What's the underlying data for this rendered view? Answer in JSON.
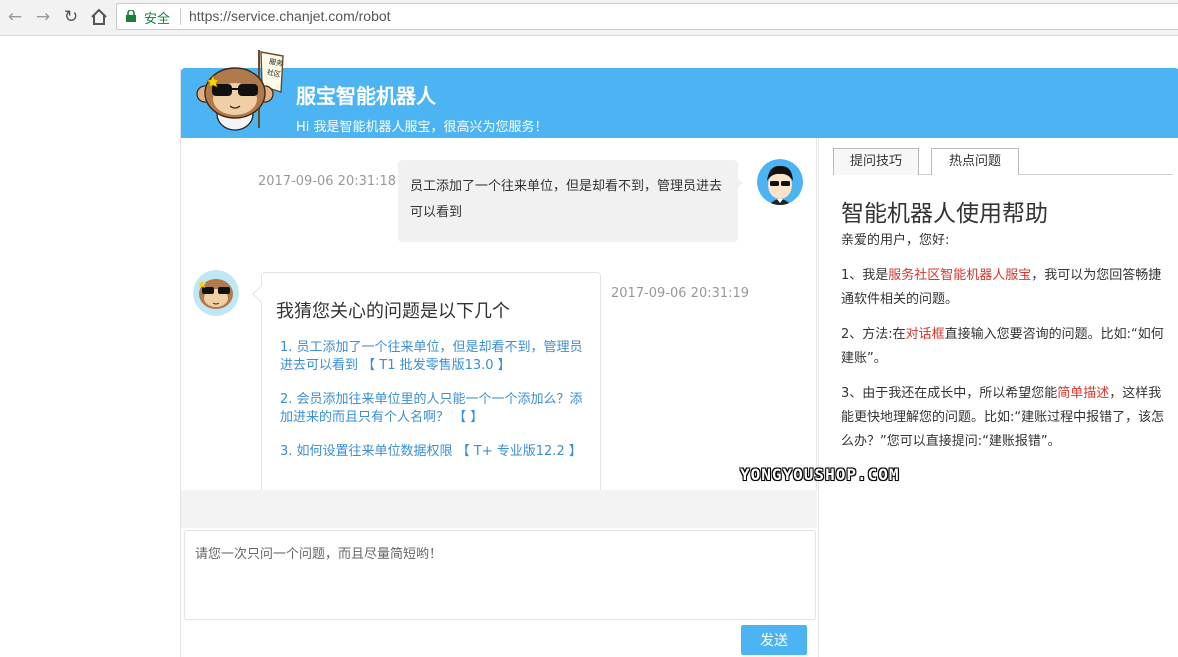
{
  "browser": {
    "security_label": "安全",
    "url": "https://service.chanjet.com/robot"
  },
  "header": {
    "title": "服宝智能机器人",
    "subtitle": "Hi 我是智能机器人服宝，很高兴为您服务！",
    "mascot_sign": "服务社区"
  },
  "chat": {
    "user_message": {
      "timestamp": "2017-09-06 20:31:18",
      "text": "员工添加了一个往来单位，但是却看不到，管理员进去可以看到"
    },
    "bot_message": {
      "timestamp": "2017-09-06 20:31:19",
      "title": "我猜您关心的问题是以下几个",
      "items": [
        "1. 员工添加了一个往来单位，但是却看不到，管理员进去可以看到 【 T1 批发零售版13.0 】",
        "2. 会员添加往来单位里的人只能一个一个添加么？添加进来的而且只有个人名啊？ 【 】",
        "3. 如何设置往来单位数据权限 【 T+ 专业版12.2 】"
      ]
    },
    "input_placeholder": "请您一次只问一个问题，而且尽量简短哟！",
    "send_label": "发送"
  },
  "right_panel": {
    "tabs": [
      "提问技巧",
      "热点问题"
    ],
    "selected_tab": "提问技巧",
    "title": "智能机器人使用帮助",
    "greeting": "亲爱的用户，您好:",
    "p1": {
      "a": "1、我是",
      "red": "服务社区智能机器人服宝",
      "b": "，我可以为您回答畅捷通软件相关的问题。"
    },
    "p2": {
      "a": "2、方法:在",
      "red": "对话框",
      "b": "直接输入您要咨询的问题。比如:“如何建账”。"
    },
    "p3": {
      "a": "3、由于我还在成长中，所以希望您能",
      "red": "简单描述",
      "b": "，这样我能更快地理解您的问题。比如:“建账过程中报错了，该怎么办？”您可以直接提问:“建账报错”。"
    }
  },
  "watermark": "YONGYOUSHOP.COM",
  "colors": {
    "brand_blue": "#4cb4f2",
    "highlight_red": "#d9342b",
    "link_blue": "#3a8fd6"
  }
}
